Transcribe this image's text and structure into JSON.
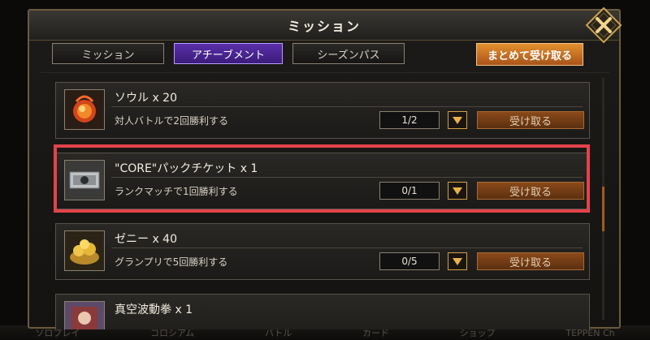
{
  "window": {
    "title": "ミッション"
  },
  "tabs": [
    {
      "label": "ミッション",
      "active": false
    },
    {
      "label": "アチーブメント",
      "active": true
    },
    {
      "label": "シーズンパス",
      "active": false
    }
  ],
  "collect_all_label": "まとめて受け取る",
  "missions": [
    {
      "reward": "ソウル x 20",
      "condition": "対人バトルで2回勝利する",
      "progress": "1/2",
      "claim_label": "受け取る",
      "icon": "soul-orb-icon"
    },
    {
      "reward": "\"CORE\"パックチケット x 1",
      "condition": "ランクマッチで1回勝利する",
      "progress": "0/1",
      "claim_label": "受け取る",
      "icon": "pack-ticket-icon"
    },
    {
      "reward": "ゼニー x 40",
      "condition": "グランプリで5回勝利する",
      "progress": "0/5",
      "claim_label": "受け取る",
      "icon": "zenny-gold-icon"
    },
    {
      "reward": "真空波動拳 x 1",
      "condition": "",
      "progress": "",
      "claim_label": "",
      "icon": "card-art-icon"
    }
  ],
  "bottom_nav": [
    "ソロプレイ",
    "コロシアム",
    "バトル",
    "カード",
    "ショップ",
    "TEPPEN Ch"
  ],
  "colors": {
    "accent_orange": "#e3902f",
    "tab_active_purple": "#5a2fa8",
    "highlight_red": "#e2434a",
    "gold_border": "#6b5a3c"
  }
}
